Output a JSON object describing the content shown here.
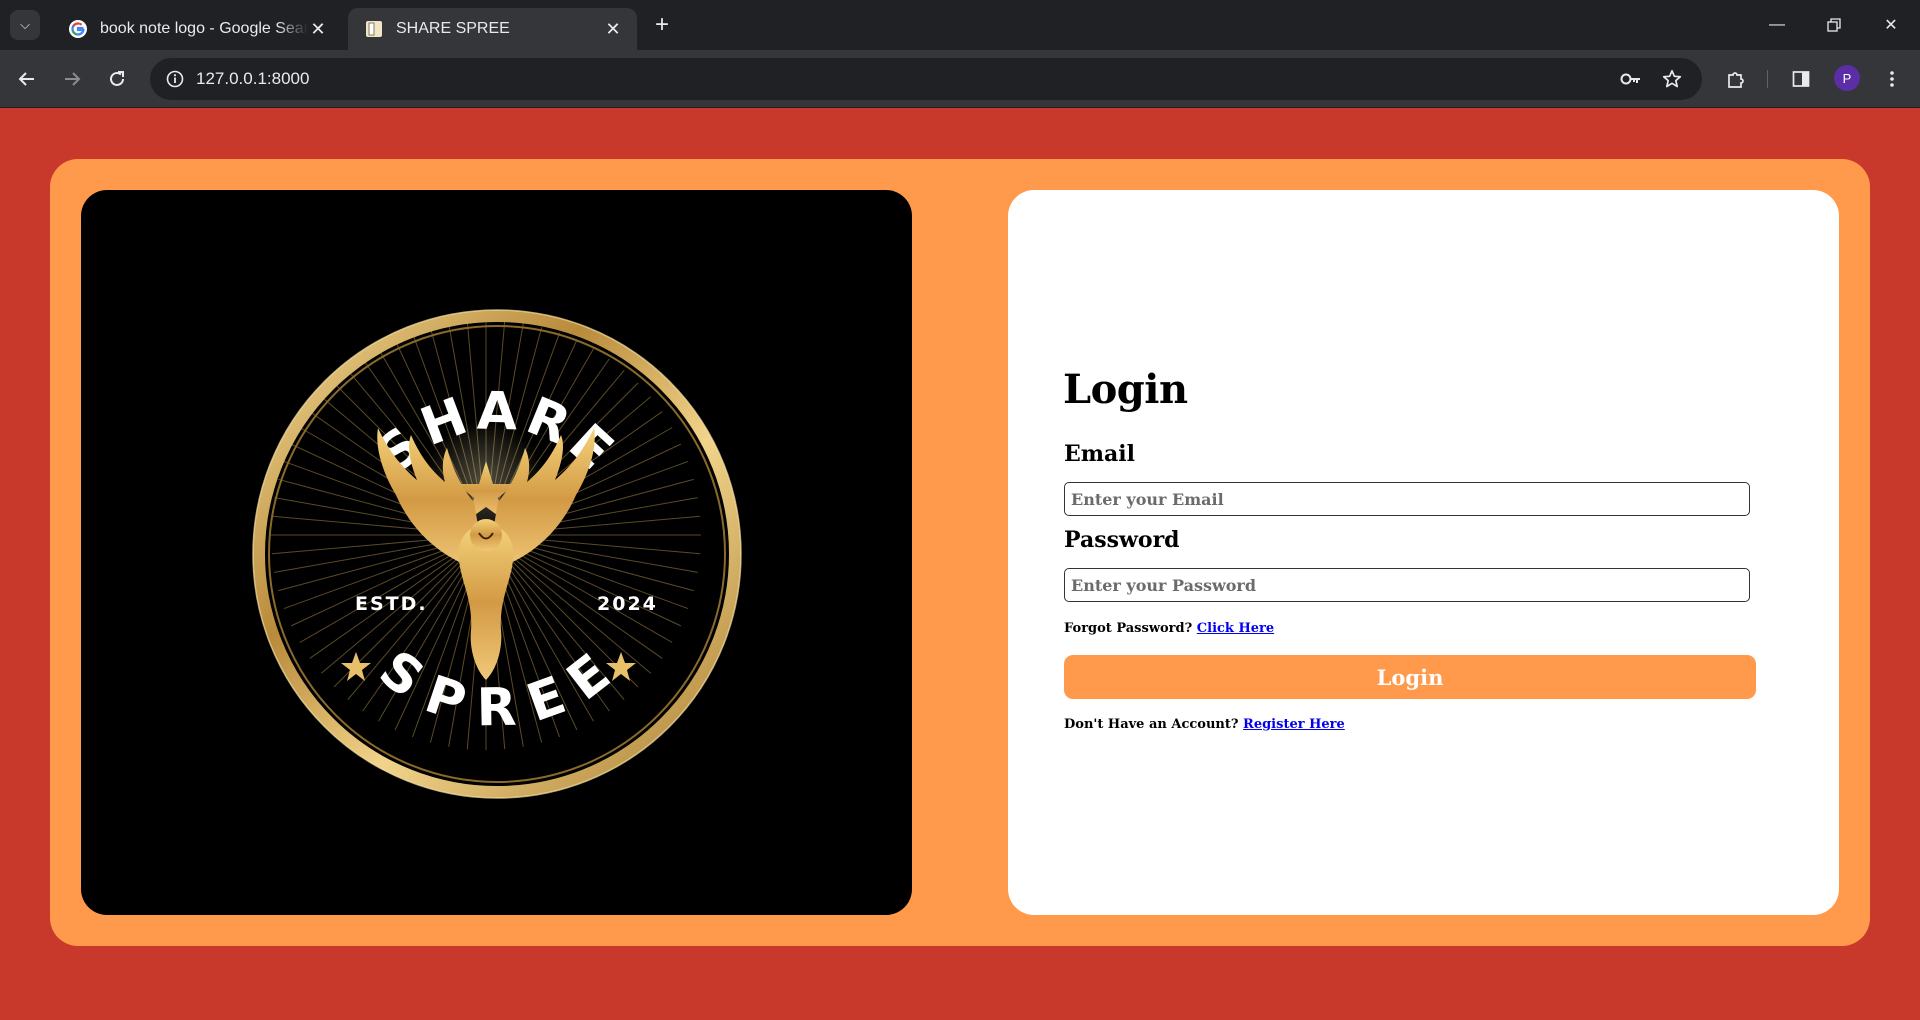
{
  "browser": {
    "tabs": [
      {
        "title": "book note logo - Google Search",
        "active": false,
        "favicon": "google-g-icon"
      },
      {
        "title": "SHARE SPREE",
        "active": true,
        "favicon": "page-favicon-icon"
      }
    ],
    "url": "127.0.0.1:8000",
    "profile_initial": "P"
  },
  "logo": {
    "top_text": "SHARE",
    "bottom_text": "SPREE",
    "left_text": "ESTD.",
    "right_text": "2024"
  },
  "login": {
    "title": "Login",
    "email_label": "Email",
    "email_placeholder": "Enter your Email",
    "email_value": "",
    "password_label": "Password",
    "password_placeholder": "Enter your Password",
    "password_value": "",
    "forgot_text": "Forgot Password?",
    "forgot_link": "Click Here",
    "button_label": "Login",
    "register_text": "Don't Have an Account?",
    "register_link": "Register Here"
  },
  "colors": {
    "page_background": "#c8392b",
    "card_background": "#ff9a4d",
    "button_background": "#ff9a4d",
    "link": "#0000ee",
    "gold": "#d4a548"
  }
}
